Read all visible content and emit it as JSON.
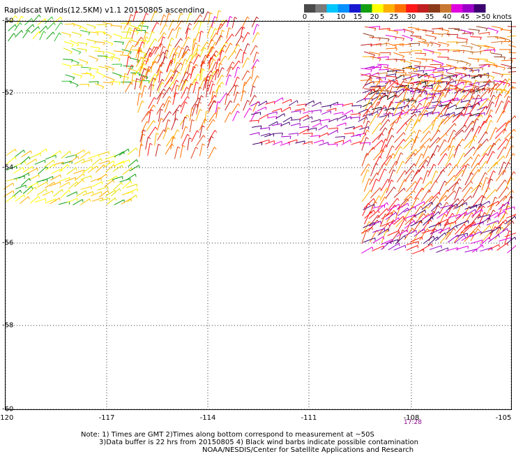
{
  "title": "Rapidscat Winds(12.5KM) v1.1 20150805 ascending",
  "legend": {
    "ticks": [
      "0",
      "5",
      "10",
      "15",
      "20",
      "25",
      "30",
      "35",
      "40",
      "45",
      ">50 knots"
    ],
    "colors": [
      "#4a4a4a",
      "#7a7a7a",
      "#00c8ff",
      "#0090ff",
      "#1818d0",
      "#12a012",
      "#ffff00",
      "#ffb000",
      "#ff7000",
      "#ff1818",
      "#c02020",
      "#8b3a1a",
      "#c87830",
      "#e000e0",
      "#9b00c8",
      "#3c0070"
    ]
  },
  "map": {
    "lat_labels": [
      "-50",
      "-52",
      "-54",
      "-56",
      "-58",
      "-60"
    ],
    "lon_labels": [
      "-120",
      "-117",
      "-114",
      "-111",
      "-108",
      "-105"
    ],
    "lon_range": [
      -120,
      -105
    ],
    "lat_range": [
      -60,
      -50
    ],
    "gridlines": "dotted",
    "time_marker": "17:28"
  },
  "notes": {
    "line1": "Note: 1) Times are GMT 2)Times along bottom correspond to measurement at ~50S",
    "line2": "3)Data buffer is 22 hrs from 20150805 4) Black wind barbs indicate possible contamination",
    "line3": "NOAA/NESDIS/Center for Satellite Applications and Research"
  }
}
